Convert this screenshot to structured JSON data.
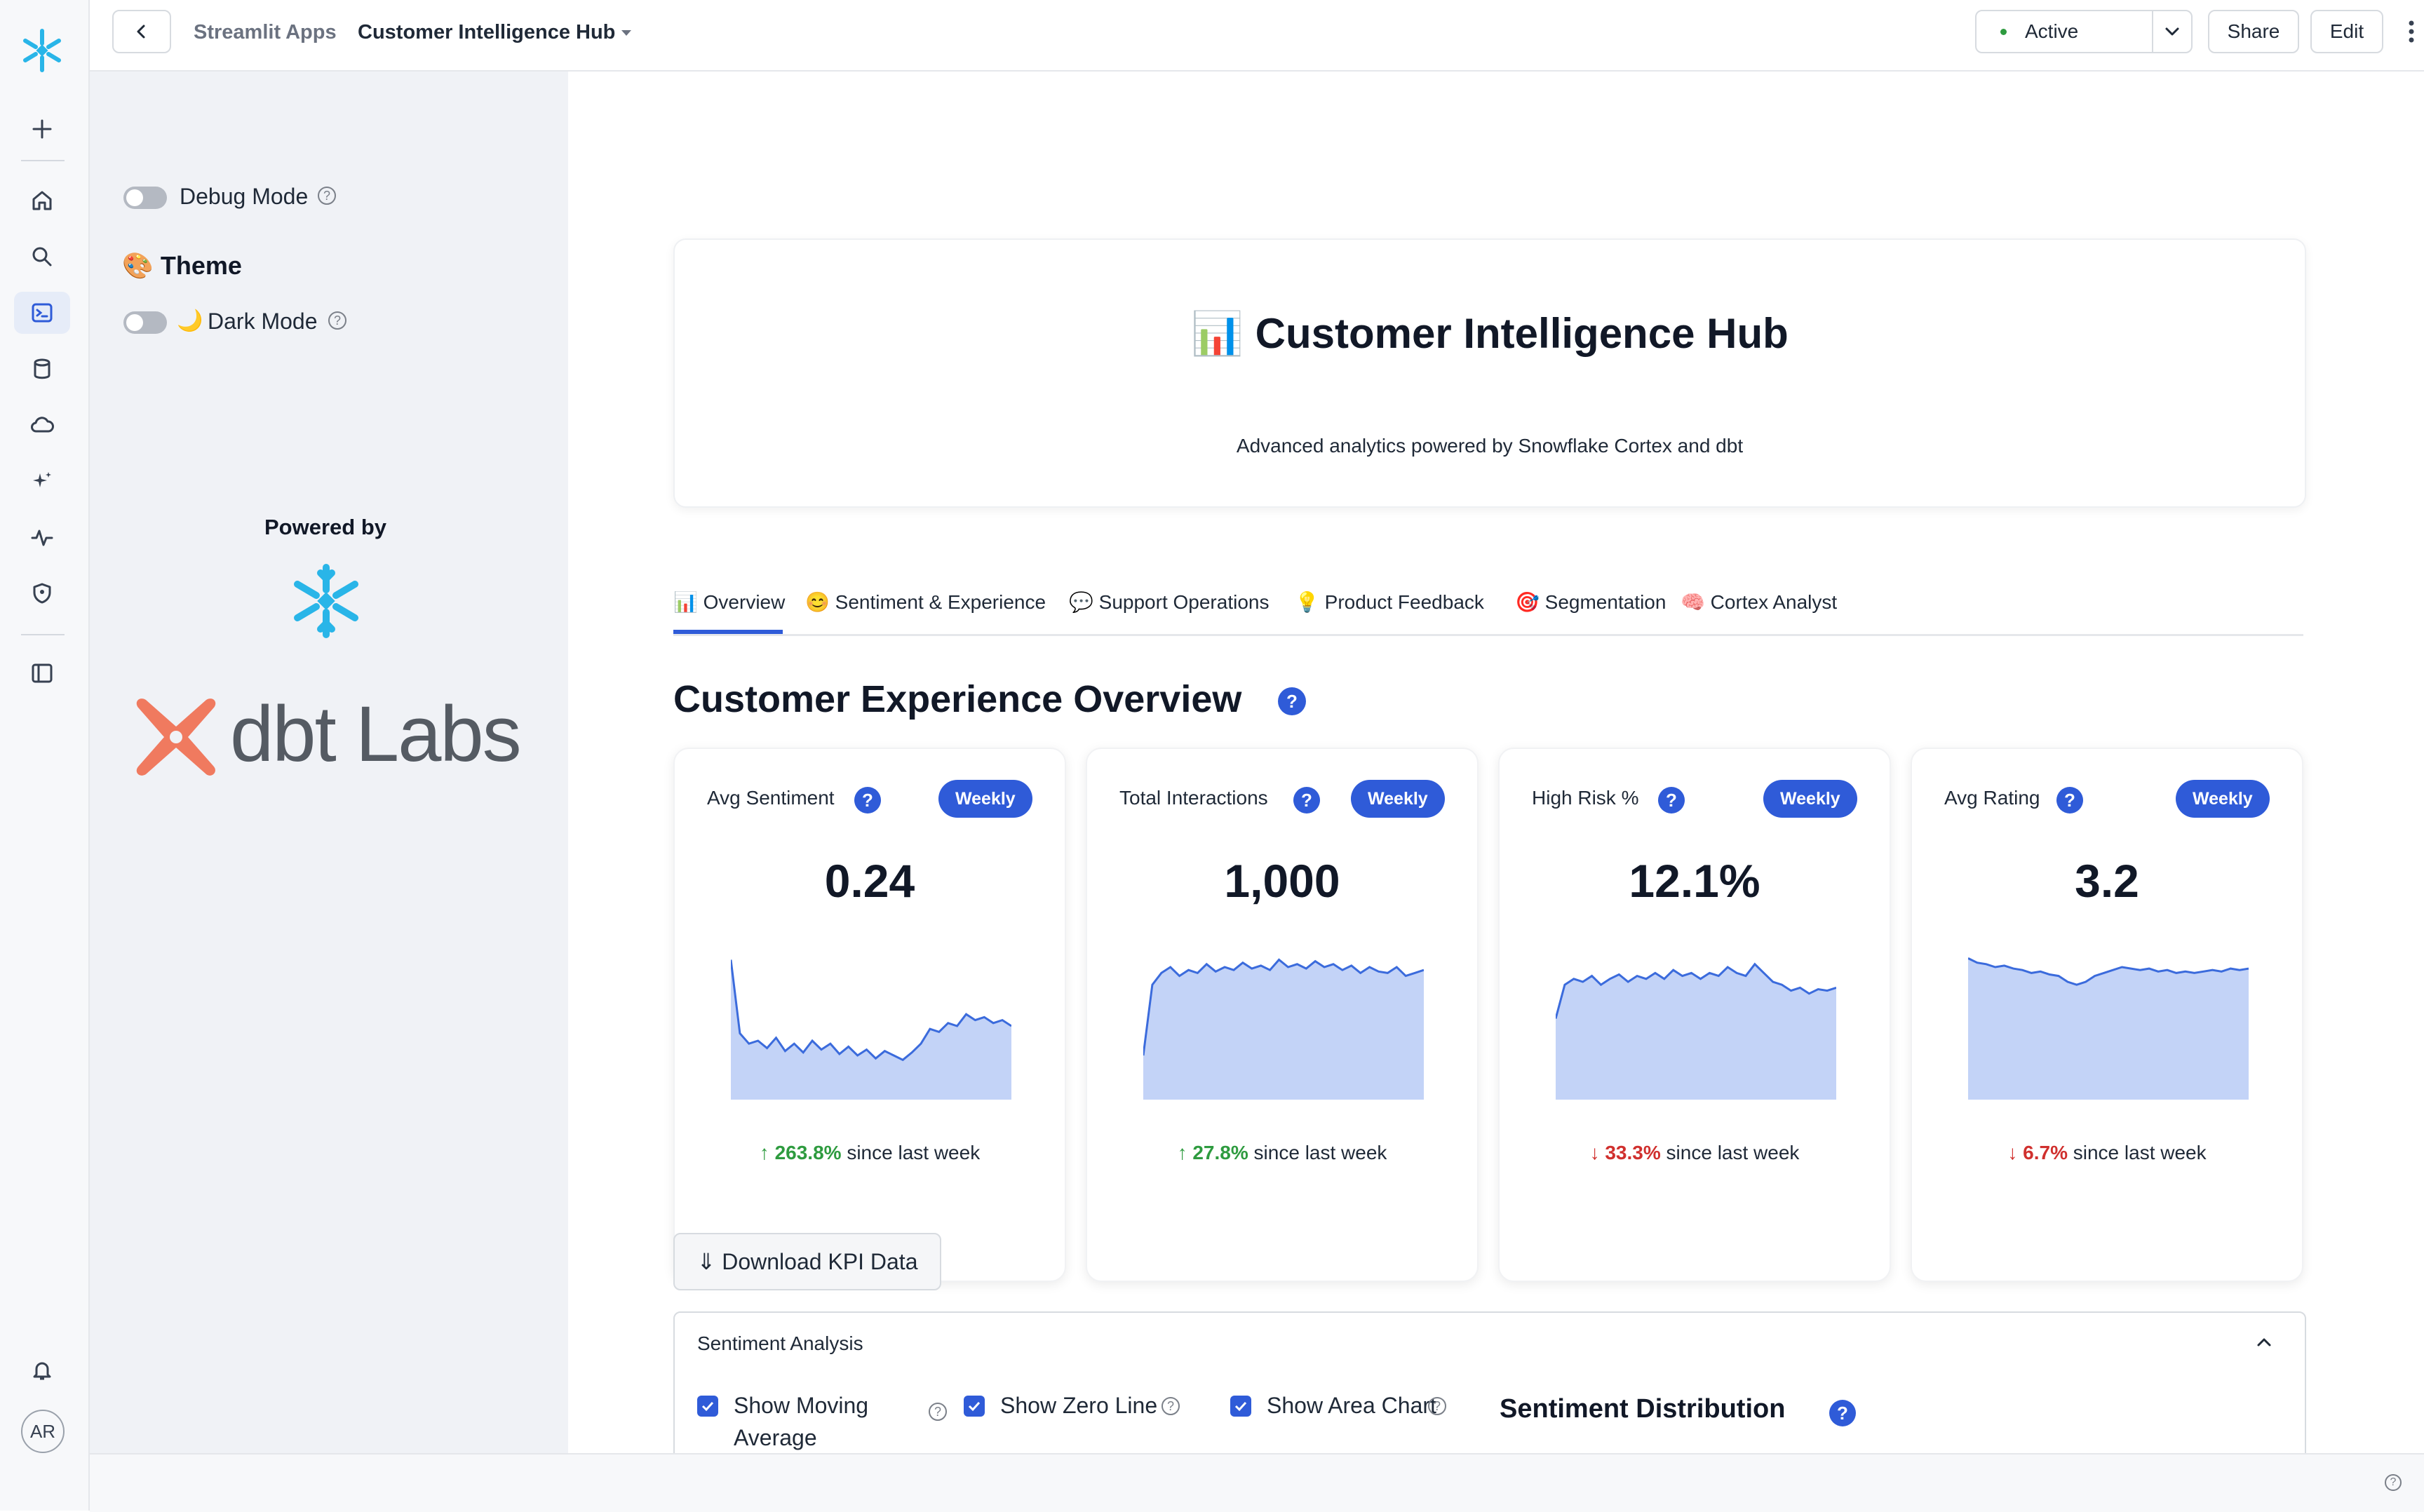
{
  "topbar": {
    "breadcrumb_parent": "Streamlit Apps",
    "app_name": "Customer Intelligence Hub",
    "status_label": "Active",
    "share_label": "Share",
    "edit_label": "Edit"
  },
  "rail": {
    "avatar_initials": "AR",
    "icons": [
      "plus-icon",
      "home-icon",
      "search-icon",
      "terminal-icon",
      "database-icon",
      "cloud-icon",
      "sparkle-icon",
      "activity-icon",
      "shield-icon",
      "panel-icon",
      "bell-icon"
    ]
  },
  "sidebar": {
    "debug_label": "Debug Mode",
    "theme_emoji": "🎨",
    "theme_heading": "Theme",
    "dark_mode_emoji": "🌙",
    "dark_mode_label": "Dark Mode",
    "powered_by": "Powered by",
    "dbt_logo_text": "dbt Labs"
  },
  "header": {
    "emoji": "📊",
    "title": "Customer Intelligence Hub",
    "subtitle": "Advanced analytics powered by Snowflake Cortex and dbt"
  },
  "tabs": [
    {
      "emoji": "📊",
      "label": "Overview"
    },
    {
      "emoji": "😊",
      "label": "Sentiment & Experience"
    },
    {
      "emoji": "💬",
      "label": "Support Operations"
    },
    {
      "emoji": "💡",
      "label": "Product Feedback"
    },
    {
      "emoji": "🎯",
      "label": "Segmentation"
    },
    {
      "emoji": "🧠",
      "label": "Cortex Analyst"
    }
  ],
  "overview": {
    "title": "Customer Experience Overview",
    "kpis": [
      {
        "label": "Avg Sentiment",
        "badge": "Weekly",
        "value": "0.24",
        "arrow": "↑",
        "delta": "263.8%",
        "delta_dir": "up",
        "suffix": "since last week",
        "spark": [
          0.95,
          0.45,
          0.38,
          0.4,
          0.35,
          0.42,
          0.33,
          0.38,
          0.32,
          0.4,
          0.34,
          0.38,
          0.31,
          0.36,
          0.3,
          0.34,
          0.28,
          0.33,
          0.3,
          0.27,
          0.32,
          0.38,
          0.48,
          0.46,
          0.52,
          0.5,
          0.58,
          0.54,
          0.56,
          0.52,
          0.54,
          0.5
        ]
      },
      {
        "label": "Total Interactions",
        "badge": "Weekly",
        "value": "1,000",
        "arrow": "↑",
        "delta": "27.8%",
        "delta_dir": "up",
        "suffix": "since last week",
        "spark": [
          0.3,
          0.78,
          0.86,
          0.9,
          0.84,
          0.88,
          0.86,
          0.92,
          0.87,
          0.9,
          0.88,
          0.93,
          0.89,
          0.91,
          0.88,
          0.95,
          0.9,
          0.92,
          0.89,
          0.94,
          0.9,
          0.92,
          0.88,
          0.91,
          0.86,
          0.9,
          0.87,
          0.86,
          0.9,
          0.84,
          0.86,
          0.88
        ]
      },
      {
        "label": "High Risk %",
        "badge": "Weekly",
        "value": "12.1%",
        "arrow": "↓",
        "delta": "33.3%",
        "delta_dir": "down",
        "suffix": "since last week",
        "spark": [
          0.55,
          0.78,
          0.82,
          0.8,
          0.84,
          0.78,
          0.82,
          0.85,
          0.8,
          0.84,
          0.82,
          0.86,
          0.82,
          0.88,
          0.84,
          0.86,
          0.82,
          0.86,
          0.84,
          0.9,
          0.86,
          0.84,
          0.92,
          0.86,
          0.8,
          0.78,
          0.74,
          0.76,
          0.72,
          0.75,
          0.74,
          0.76
        ]
      },
      {
        "label": "Avg Rating",
        "badge": "Weekly",
        "value": "3.2",
        "arrow": "↓",
        "delta": "6.7%",
        "delta_dir": "down",
        "suffix": "since last week",
        "spark": [
          0.96,
          0.93,
          0.92,
          0.9,
          0.91,
          0.89,
          0.88,
          0.86,
          0.87,
          0.85,
          0.84,
          0.8,
          0.78,
          0.8,
          0.84,
          0.86,
          0.88,
          0.9,
          0.89,
          0.88,
          0.89,
          0.87,
          0.88,
          0.86,
          0.87,
          0.86,
          0.87,
          0.88,
          0.87,
          0.89,
          0.88,
          0.89
        ]
      }
    ],
    "download_label": "⇓ Download KPI Data"
  },
  "sentiment_analysis": {
    "title": "Sentiment Analysis",
    "moving_avg_label_1": "Show Moving",
    "moving_avg_label_2": "Average",
    "zero_line_label": "Show Zero Line",
    "area_chart_label": "Show Area Chart",
    "distribution_title": "Sentiment Distribution"
  },
  "colors": {
    "accent": "#2f5bd8",
    "snowflake": "#29b5e8",
    "dbt": "#f07a5f",
    "up": "#2e9b3f",
    "down": "#d0302e",
    "spark_fill": "#c3d3f7",
    "spark_line": "#3b6bdc"
  }
}
